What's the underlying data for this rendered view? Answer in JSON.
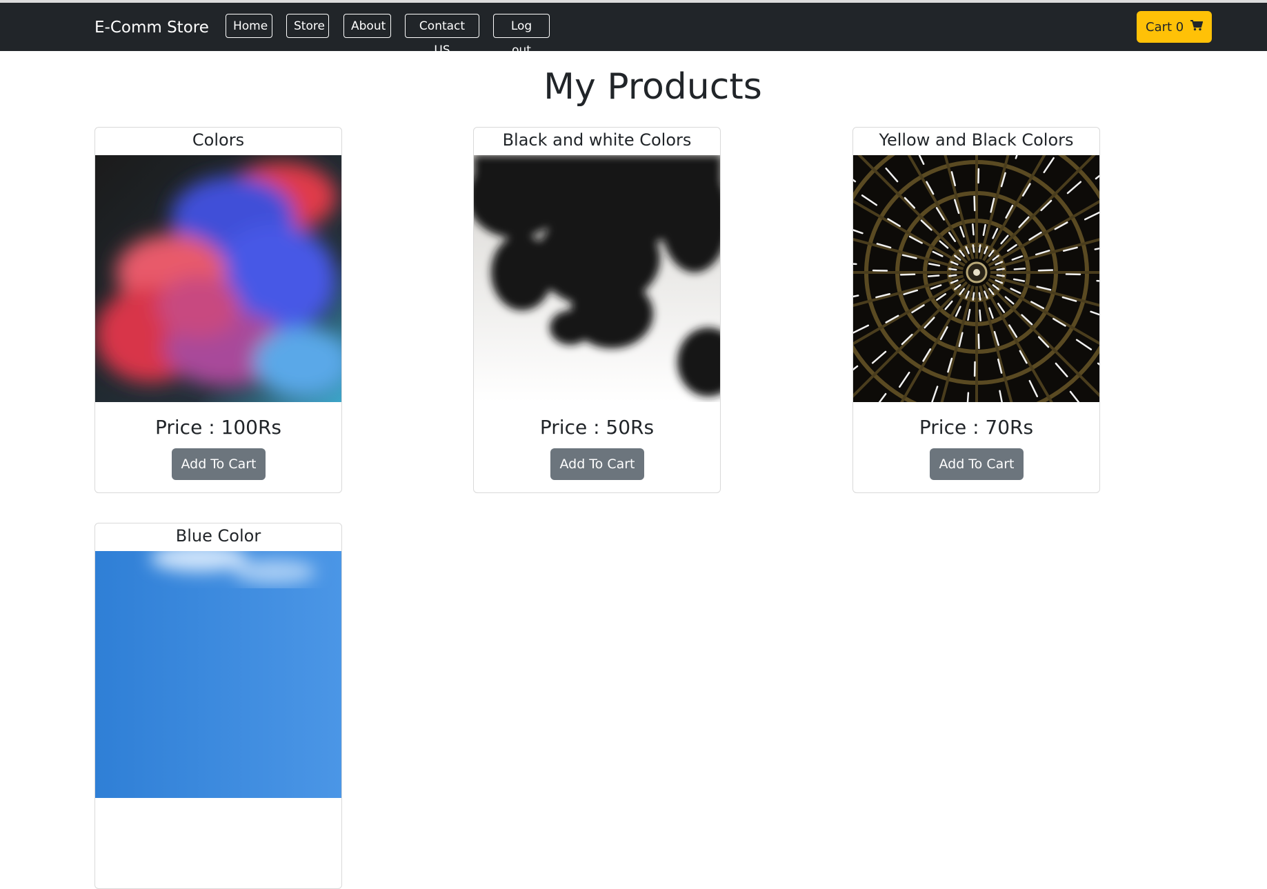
{
  "navbar": {
    "brand": "E-Comm Store",
    "links": [
      "Home",
      "Store",
      "About",
      "Contact US",
      "Log out"
    ],
    "cart_label": "Cart 0",
    "cart_icon": "cart-icon",
    "background": "#212529",
    "cart_color": "#ffc107"
  },
  "page": {
    "title": "My Products"
  },
  "products": [
    {
      "title": "Colors",
      "price": "Price : 100Rs",
      "button": "Add To Cart",
      "image": "colorful-smoke-image"
    },
    {
      "title": "Black and white Colors",
      "price": "Price : 50Rs",
      "button": "Add To Cart",
      "image": "black-ink-image"
    },
    {
      "title": "Yellow and Black Colors",
      "price": "Price : 70Rs",
      "button": "Add To Cart",
      "image": "radial-lights-image"
    },
    {
      "title": "Blue Color",
      "image": "blue-sky-image"
    }
  ],
  "colors": {
    "button": "#6c757d",
    "text": "#212529"
  }
}
